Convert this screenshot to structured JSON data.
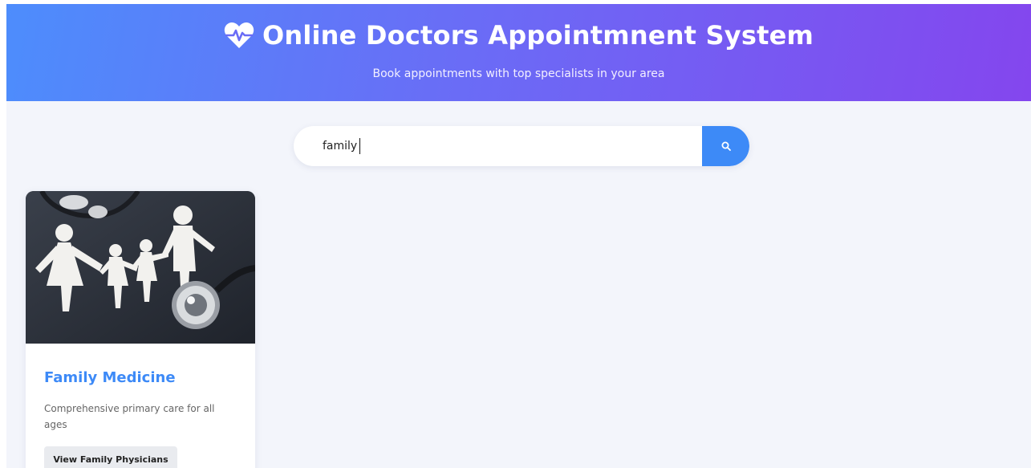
{
  "header": {
    "title": "Online Doctors Appointmnent System",
    "subtitle": "Book appointments with top specialists in your area",
    "icon": "heartbeat-icon"
  },
  "search": {
    "value": "family",
    "button_icon": "search-icon"
  },
  "results": [
    {
      "title": "Family Medicine",
      "description": "Comprehensive primary care for all ages",
      "button_label": "View Family Physicians",
      "image": "family-medicine-image"
    }
  ],
  "colors": {
    "header_gradient_start": "#4d8dfc",
    "header_gradient_end": "#8446ee",
    "accent": "#3d8af7",
    "background": "#f3f5fb"
  }
}
